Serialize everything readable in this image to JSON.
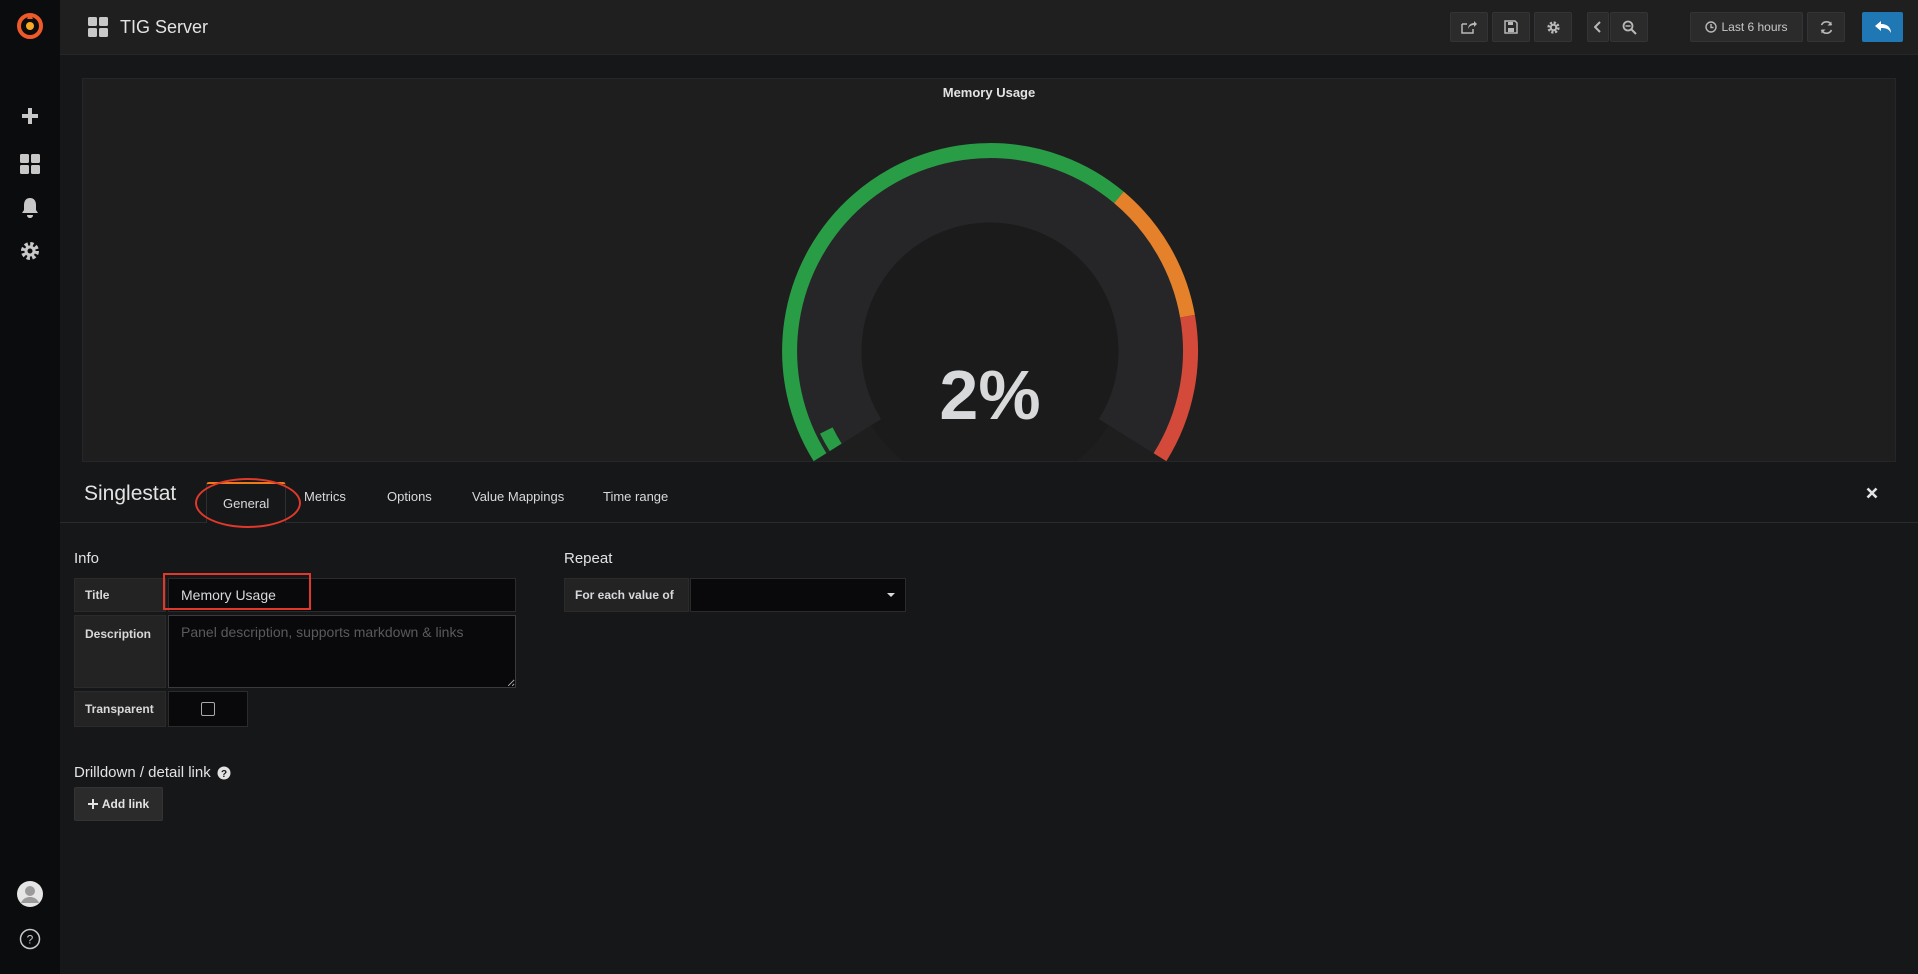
{
  "header": {
    "dashboard_title": "TIG Server",
    "time_range_label": "Last 6 hours"
  },
  "sidebar": {
    "items": [
      {
        "icon": "grafana-logo-icon"
      },
      {
        "icon": "plus-icon"
      },
      {
        "icon": "dashboards-icon"
      },
      {
        "icon": "bell-icon"
      },
      {
        "icon": "gear-icon"
      },
      {
        "icon": "avatar"
      },
      {
        "icon": "help-icon"
      }
    ]
  },
  "panel": {
    "title": "Memory Usage",
    "value_text": "2%",
    "value_percent": 2,
    "threshold_colors": [
      "#299c46",
      "#e5812a",
      "#d44a3a"
    ]
  },
  "editor": {
    "type_title": "Singlestat",
    "tabs": [
      "General",
      "Metrics",
      "Options",
      "Value Mappings",
      "Time range"
    ],
    "active_tab": "General",
    "info_section": "Info",
    "title_label": "Title",
    "title_value": "Memory Usage",
    "description_label": "Description",
    "description_placeholder": "Panel description, supports markdown & links",
    "transparent_label": "Transparent",
    "repeat_section": "Repeat",
    "repeat_label": "For each value of",
    "drilldown_section": "Drilldown / detail link",
    "add_link_label": "Add link"
  }
}
